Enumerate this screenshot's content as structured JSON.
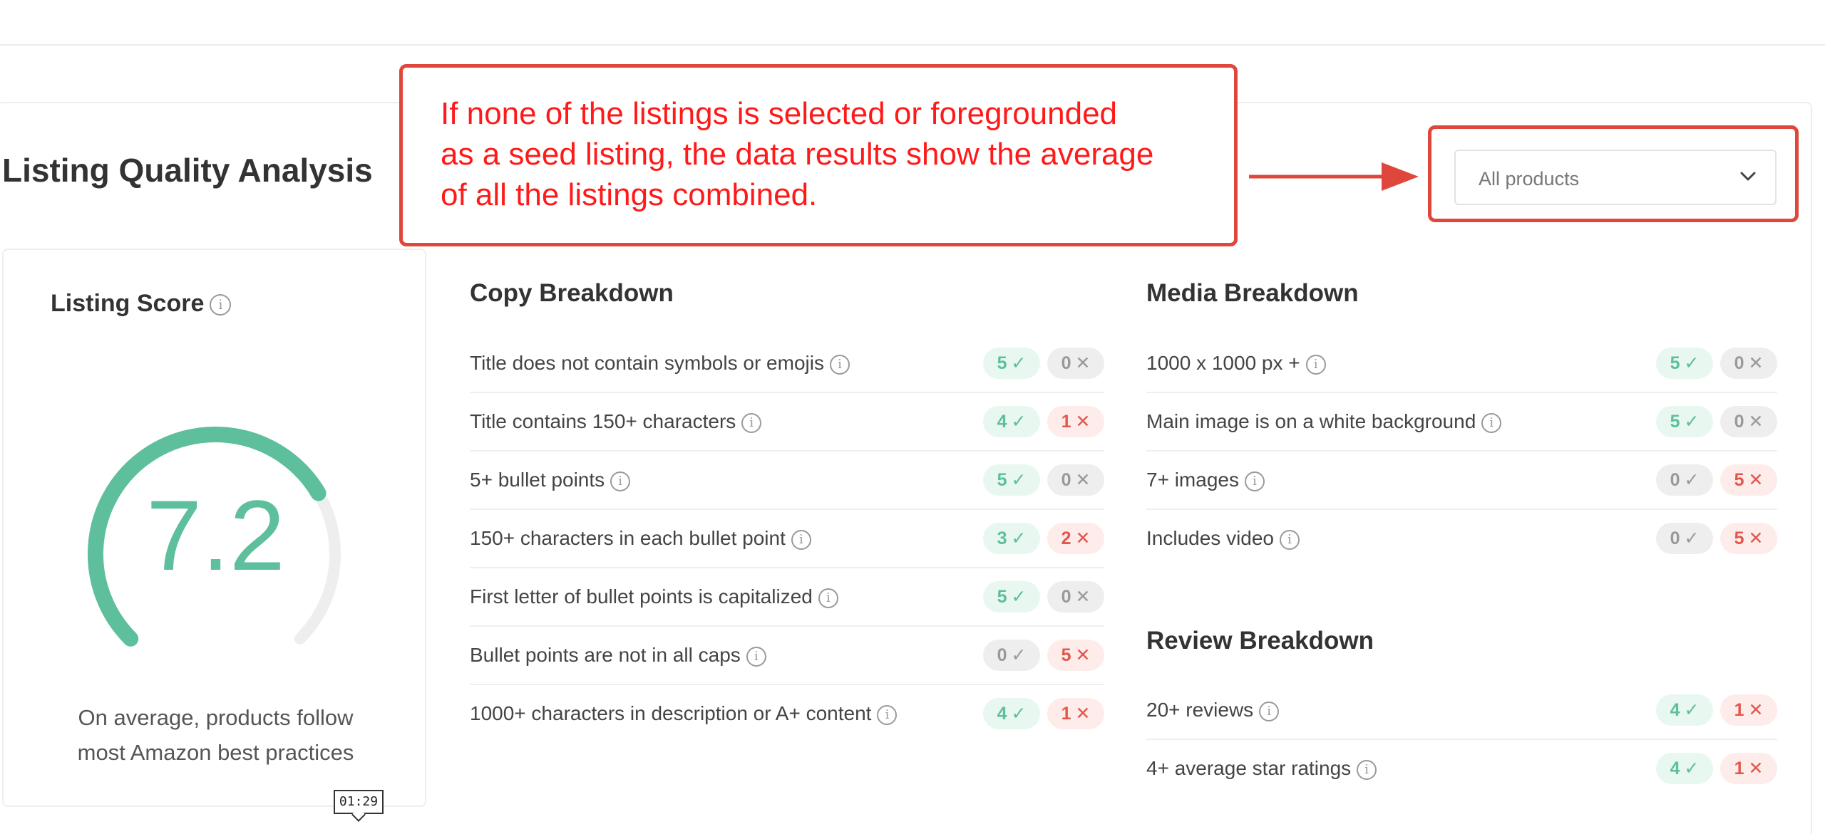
{
  "page": {
    "title": "Listing Quality Analysis"
  },
  "annotation": {
    "text_lines": [
      "If none of the listings is selected or foregrounded",
      "as a seed listing, the data results show the average",
      "of all the listings combined."
    ],
    "color": "#ff1a1a",
    "border_color": "#e0473c"
  },
  "product_select": {
    "value": "All products",
    "icon": "chevron-down-icon"
  },
  "score_card": {
    "title": "Listing Score",
    "score": "7.2",
    "score_out_of_10": 7.2,
    "caption_lines": [
      "On average, products follow",
      "most Amazon best practices"
    ],
    "accent_color": "#5dbf9b"
  },
  "copy_breakdown": {
    "title": "Copy Breakdown",
    "rows": [
      {
        "label": "Title does not contain symbols or emojis",
        "pass": "5",
        "fail": "0"
      },
      {
        "label": "Title contains 150+ characters",
        "pass": "4",
        "fail": "1"
      },
      {
        "label": "5+ bullet points",
        "pass": "5",
        "fail": "0"
      },
      {
        "label": "150+ characters in each bullet point",
        "pass": "3",
        "fail": "2"
      },
      {
        "label": "First letter of bullet points is capitalized",
        "pass": "5",
        "fail": "0"
      },
      {
        "label": "Bullet points are not in all caps",
        "pass": "0",
        "fail": "5"
      },
      {
        "label": "1000+ characters in description or A+ content",
        "pass": "4",
        "fail": "1"
      }
    ]
  },
  "media_breakdown": {
    "title": "Media Breakdown",
    "rows": [
      {
        "label": "1000 x 1000 px +",
        "pass": "5",
        "fail": "0"
      },
      {
        "label": "Main image is on a white background",
        "pass": "5",
        "fail": "0"
      },
      {
        "label": "7+ images",
        "pass": "0",
        "fail": "5"
      },
      {
        "label": "Includes video",
        "pass": "0",
        "fail": "5"
      }
    ]
  },
  "review_breakdown": {
    "title": "Review Breakdown",
    "rows": [
      {
        "label": "20+ reviews",
        "pass": "4",
        "fail": "1"
      },
      {
        "label": "4+ average star ratings",
        "pass": "4",
        "fail": "1"
      }
    ]
  },
  "marks": {
    "check": "✓",
    "cross": "✕"
  },
  "video_timestamp": "01:29"
}
